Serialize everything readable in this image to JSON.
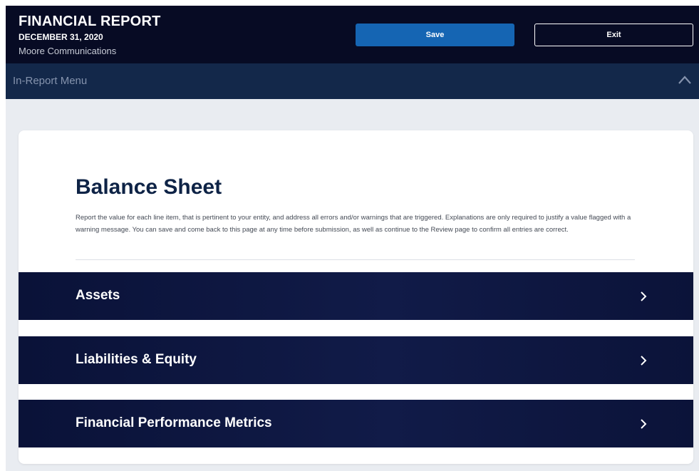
{
  "header": {
    "title": "FINANCIAL REPORT",
    "date": "DECEMBER 31, 2020",
    "entity": "Moore Communications",
    "save_label": "Save",
    "exit_label": "Exit"
  },
  "menu": {
    "label": "In-Report Menu",
    "toggle_icon": "chevron-up-icon"
  },
  "main": {
    "title": "Balance Sheet",
    "description": "Report the value for each line item, that is pertinent to your entity, and address all errors and/or warnings that are triggered. Explanations are only required to justify a value flagged with a warning message. You can save and come back to this page at any time before submission, as well as continue to the Review page to confirm all entries are correct.",
    "sections": [
      {
        "label": "Assets",
        "icon": "chevron-right-icon"
      },
      {
        "label": "Liabilities & Equity",
        "icon": "chevron-right-icon"
      },
      {
        "label": "Financial Performance Metrics",
        "icon": "chevron-right-icon"
      }
    ]
  },
  "colors": {
    "header_bg": "#070b24",
    "menu_bg": "#13284a",
    "primary_button": "#1565b3",
    "section_bg": "#0a1238",
    "title_text": "#0e2346",
    "page_bg": "#e9ecf1"
  }
}
